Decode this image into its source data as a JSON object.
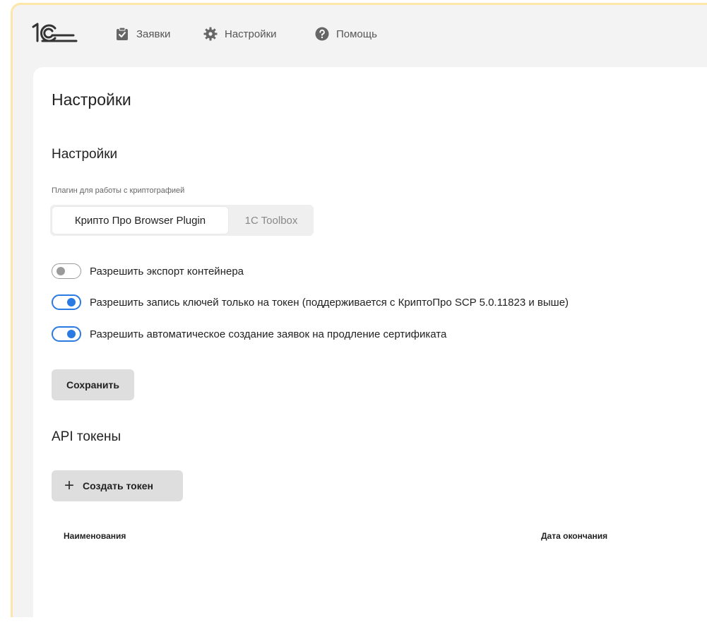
{
  "nav": {
    "logo": "1С",
    "items": [
      {
        "label": "Заявки",
        "icon": "clipboard-check-icon"
      },
      {
        "label": "Настройки",
        "icon": "gear-icon"
      },
      {
        "label": "Помощь",
        "icon": "help-circle-icon"
      }
    ]
  },
  "page": {
    "title": "Настройки"
  },
  "settings": {
    "section_title": "Настройки",
    "plugin_label": "Плагин для работы с криптографией",
    "plugin_options": [
      "Крипто Про Browser Plugin",
      "1C Toolbox"
    ],
    "plugin_selected": "Крипто Про Browser Plugin",
    "toggles": [
      {
        "label": "Разрешить экспорт контейнера",
        "on": false
      },
      {
        "label": "Разрешить запись ключей только на токен (поддерживается с КриптоПро SCP 5.0.11823 и выше)",
        "on": true
      },
      {
        "label": "Разрешить автоматическое создание заявок на продление сертификата",
        "on": true
      }
    ],
    "save_label": "Сохранить"
  },
  "api_tokens": {
    "section_title": "API токены",
    "create_label": "Создать токен",
    "columns": [
      "Наименования",
      "Дата окончания"
    ]
  },
  "colors": {
    "accent": "#2a7ae4",
    "frame_border": "#fde6a8",
    "background": "#f3f3f3",
    "button_bg": "#dedede"
  }
}
